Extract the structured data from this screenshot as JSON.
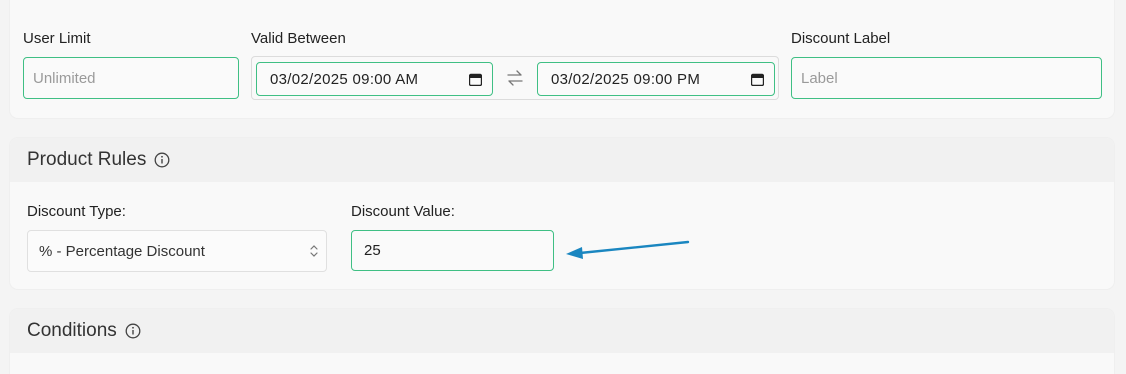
{
  "validity": {
    "user_limit": {
      "label": "User Limit",
      "placeholder": "Unlimited"
    },
    "valid_between": {
      "label": "Valid Between",
      "start": "03/02/2025 09:00 AM",
      "end": "03/02/2025 09:00 PM"
    },
    "discount_label": {
      "label": "Discount Label",
      "placeholder": "Label"
    }
  },
  "product_rules": {
    "title": "Product Rules",
    "discount_type": {
      "label": "Discount Type:",
      "selected": "% - Percentage Discount"
    },
    "discount_value": {
      "label": "Discount Value:",
      "value": "25"
    }
  },
  "conditions": {
    "title": "Conditions"
  },
  "colors": {
    "accent": "#3fbf84",
    "arrow": "#1a86c0"
  },
  "icons": [
    "calendar-icon",
    "swap-icon",
    "info-icon",
    "select-chevron-icon",
    "annotation-arrow"
  ]
}
